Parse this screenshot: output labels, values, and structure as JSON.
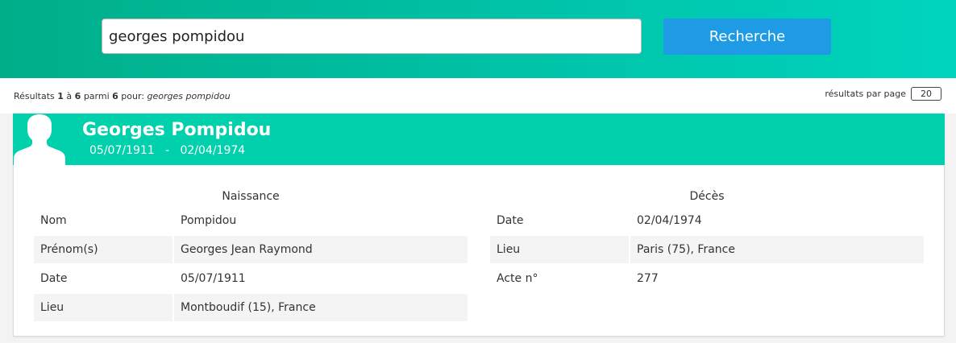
{
  "search": {
    "query": "georges pompidou",
    "button_label": "Recherche"
  },
  "results": {
    "prefix": "Résultats ",
    "from": "1",
    "sep1": " à ",
    "to": "6",
    "sep2": " parmi ",
    "total": "6",
    "sep3": " pour: ",
    "query": "georges pompidou",
    "per_page_label": "résultats par page",
    "per_page_value": "20"
  },
  "person": {
    "name": "Georges Pompidou",
    "birth_date": "05/07/1911",
    "date_separator": "-",
    "death_date": "02/04/1974",
    "avatar_icon": "person-silhouette-icon"
  },
  "birth": {
    "title": "Naissance",
    "rows": [
      {
        "label": "Nom",
        "value": "Pompidou"
      },
      {
        "label": "Prénom(s)",
        "value": "Georges Jean Raymond"
      },
      {
        "label": "Date",
        "value": "05/07/1911"
      },
      {
        "label": "Lieu",
        "value": "Montboudif (15), France"
      }
    ]
  },
  "death": {
    "title": "Décès",
    "rows": [
      {
        "label": "Date",
        "value": "02/04/1974"
      },
      {
        "label": "Lieu",
        "value": "Paris (75), France"
      },
      {
        "label": "Acte n°",
        "value": "277"
      }
    ]
  },
  "colors": {
    "header_gradient_start": "#00ae8a",
    "header_gradient_end": "#00d4bf",
    "card_header": "#00d0ac",
    "button": "#1f9be6"
  }
}
